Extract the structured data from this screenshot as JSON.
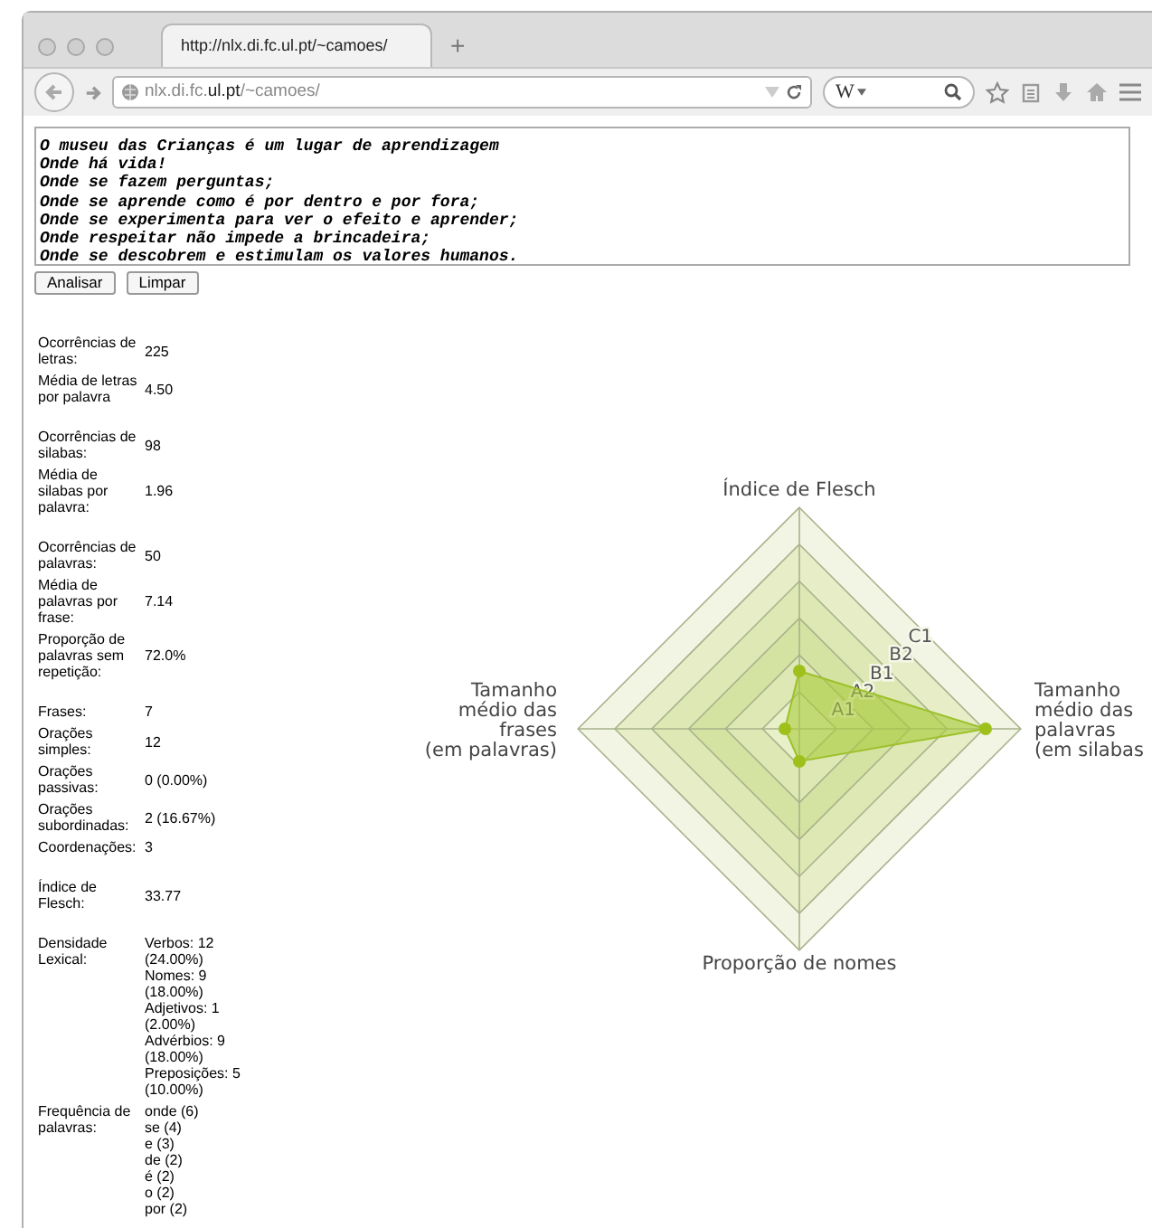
{
  "browser": {
    "tab_title": "http://nlx.di.fc.ul.pt/~camoes/",
    "new_tab": "+",
    "url_host": "nlx.di.fc.",
    "url_domain": "ul.pt",
    "url_path": "/~camoes/",
    "search_engine": "W"
  },
  "input": {
    "value": "O museu das Crianças é um lugar de aprendizagem\nOnde há vida!\nOnde se fazem perguntas;\nOnde se aprende como é por dentro e por fora;\nOnde se experimenta para ver o efeito e aprender;\nOnde respeitar não impede a brincadeira;\nOnde se descobrem e estimulam os valores humanos."
  },
  "buttons": [
    "Analisar",
    "Limpar"
  ],
  "stats": [
    [
      {
        "label": "Ocorrências de letras:",
        "values": [
          "225"
        ]
      },
      {
        "label": "Média de letras por palavra",
        "values": [
          "4.50"
        ]
      }
    ],
    [
      {
        "label": "Ocorrências de silabas:",
        "values": [
          "98"
        ]
      },
      {
        "label": "Média de silabas por palavra:",
        "values": [
          "1.96"
        ]
      }
    ],
    [
      {
        "label": "Ocorrências de palavras:",
        "values": [
          "50"
        ]
      },
      {
        "label": "Média de palavras por frase:",
        "values": [
          "7.14"
        ]
      },
      {
        "label": "Proporção de palavras sem repetição:",
        "values": [
          "72.0%"
        ]
      }
    ],
    [
      {
        "label": "Frases:",
        "values": [
          "7"
        ]
      },
      {
        "label": "Orações simples:",
        "values": [
          "12"
        ]
      },
      {
        "label": "Orações passivas:",
        "values": [
          "0 (0.00%)"
        ]
      },
      {
        "label": "Orações subordinadas:",
        "values": [
          "2 (16.67%)"
        ]
      },
      {
        "label": "Coordenações:",
        "values": [
          "3"
        ]
      }
    ],
    [
      {
        "label": "Índice de Flesch:",
        "values": [
          "33.77"
        ]
      }
    ],
    [
      {
        "label": "Densidade Lexical:",
        "values": [
          "Verbos: 12 (24.00%)",
          "Nomes: 9 (18.00%)",
          "Adjetivos: 1 (2.00%)",
          "Advérbios: 9 (18.00%)",
          "Preposições: 5 (10.00%)"
        ]
      },
      {
        "label": "Frequência de palavras:",
        "values": [
          "onde (6)",
          "se (4)",
          "e (3)",
          "de (2)",
          "é (2)",
          "o (2)",
          "por (2)"
        ]
      }
    ]
  ],
  "radar": {
    "axes": [
      {
        "lines": [
          "Índice de Flesch"
        ]
      },
      {
        "lines": [
          "Tamanho",
          "médio das",
          "palavras",
          "(em silabas"
        ]
      },
      {
        "lines": [
          "Proporção de nomes"
        ]
      },
      {
        "lines": [
          "Tamanho",
          "médio das",
          "frases",
          "(em palavras)"
        ]
      }
    ],
    "levels": [
      "A1",
      "A2",
      "B1",
      "B2",
      "C1"
    ]
  }
}
